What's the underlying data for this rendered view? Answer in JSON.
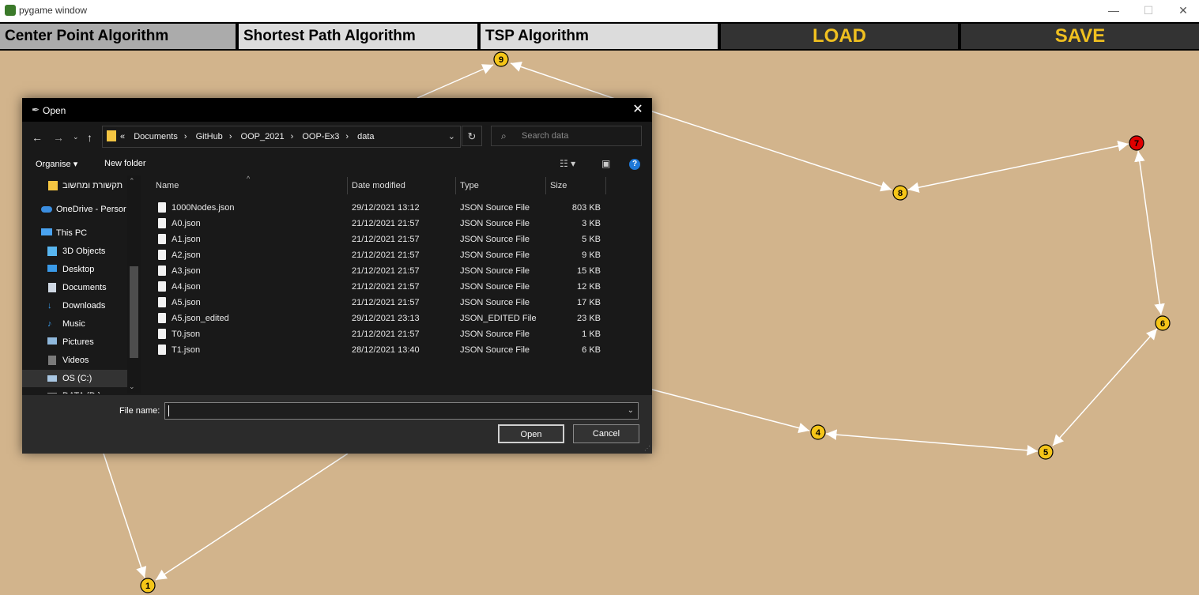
{
  "window": {
    "title": "pygame window",
    "controls": [
      "—",
      "☐",
      "✕"
    ]
  },
  "toolbar": {
    "buttons": [
      {
        "label": "Center Point Algorithm"
      },
      {
        "label": "Shortest Path Algorithm"
      },
      {
        "label": "TSP Algorithm"
      },
      {
        "label": "LOAD"
      },
      {
        "label": "SAVE"
      }
    ]
  },
  "graph": {
    "nodes": [
      {
        "id": "9",
        "color": "#f5c518"
      },
      {
        "id": "7",
        "color": "#e00000"
      },
      {
        "id": "8",
        "color": "#f5c518"
      },
      {
        "id": "6",
        "color": "#f5c518"
      },
      {
        "id": "5",
        "color": "#f5c518"
      },
      {
        "id": "4",
        "color": "#f5c518"
      },
      {
        "id": "1",
        "color": "#f5c518"
      }
    ],
    "edge_color": "#ffffff"
  },
  "dialog": {
    "title": "Open",
    "breadcrumbs": [
      "Documents",
      "GitHub",
      "OOP_2021",
      "OOP-Ex3",
      "data"
    ],
    "search_placeholder": "Search data",
    "organise_label": "Organise ▾",
    "new_folder_label": "New folder",
    "nav_items": [
      {
        "label": "תקשורת ומחשוב",
        "icon": "folder-icon"
      },
      {
        "label": "OneDrive - Persor",
        "icon": "cloud-icon"
      },
      {
        "label": "This PC",
        "icon": "computer-icon"
      },
      {
        "label": "3D Objects",
        "icon": "cube-icon"
      },
      {
        "label": "Desktop",
        "icon": "desktop-icon"
      },
      {
        "label": "Documents",
        "icon": "document-icon"
      },
      {
        "label": "Downloads",
        "icon": "download-icon"
      },
      {
        "label": "Music",
        "icon": "music-icon"
      },
      {
        "label": "Pictures",
        "icon": "picture-icon"
      },
      {
        "label": "Videos",
        "icon": "video-icon"
      },
      {
        "label": "OS (C:)",
        "icon": "drive-icon"
      },
      {
        "label": "DATA (D:)",
        "icon": "drive-icon"
      }
    ],
    "columns": [
      "Name",
      "Date modified",
      "Type",
      "Size"
    ],
    "files": [
      {
        "name": "1000Nodes.json",
        "date": "29/12/2021 13:12",
        "type": "JSON Source File",
        "size": "803 KB"
      },
      {
        "name": "A0.json",
        "date": "21/12/2021 21:57",
        "type": "JSON Source File",
        "size": "3 KB"
      },
      {
        "name": "A1.json",
        "date": "21/12/2021 21:57",
        "type": "JSON Source File",
        "size": "5 KB"
      },
      {
        "name": "A2.json",
        "date": "21/12/2021 21:57",
        "type": "JSON Source File",
        "size": "9 KB"
      },
      {
        "name": "A3.json",
        "date": "21/12/2021 21:57",
        "type": "JSON Source File",
        "size": "15 KB"
      },
      {
        "name": "A4.json",
        "date": "21/12/2021 21:57",
        "type": "JSON Source File",
        "size": "12 KB"
      },
      {
        "name": "A5.json",
        "date": "21/12/2021 21:57",
        "type": "JSON Source File",
        "size": "17 KB"
      },
      {
        "name": "A5.json_edited",
        "date": "29/12/2021 23:13",
        "type": "JSON_EDITED File",
        "size": "23 KB"
      },
      {
        "name": "T0.json",
        "date": "21/12/2021 21:57",
        "type": "JSON Source File",
        "size": "1 KB"
      },
      {
        "name": "T1.json",
        "date": "28/12/2021 13:40",
        "type": "JSON Source File",
        "size": "6 KB"
      }
    ],
    "file_name_label": "File name:",
    "file_name_value": "",
    "open_label": "Open",
    "cancel_label": "Cancel"
  }
}
